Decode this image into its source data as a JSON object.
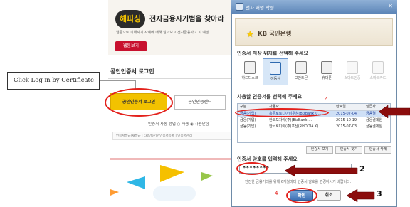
{
  "background_page": {
    "banner": {
      "logo": "해피싱",
      "title": "전자금융사기범을 찾아라",
      "subtitle": "웹툰으로 피해사기 사례에 대해 알아보고 전자금융사고 피 예방",
      "button": "웹툰보기"
    },
    "cert_login_title": "공인인증서 로그인",
    "login_button": "공인인증서 로그인",
    "center_button": "공인인증센터",
    "auto_login_label": "인증서 자동 갱업  ○ 사용  ◉ 사용안함",
    "links": "인증서발급/재발급 | 타행/타기관인증서등록 | 인증서관리"
  },
  "annotation": {
    "note": "Click Log in by Certificate",
    "step_numbers": [
      "2",
      "3"
    ],
    "small_numbers": [
      "2",
      "3",
      "4"
    ]
  },
  "dialog": {
    "title": "전자 서명 작성",
    "close": "✕",
    "bank_name": "KB 국민은행",
    "storage_section_title": "인증서 저장 위치를 선택해 주세요",
    "storage_options": [
      {
        "label": "하드디스크",
        "state": "normal"
      },
      {
        "label": "이동식",
        "state": "selected"
      },
      {
        "label": "보안토큰",
        "state": "normal"
      },
      {
        "label": "휴대폰",
        "state": "normal"
      },
      {
        "label": "스마트인증",
        "state": "disabled"
      },
      {
        "label": "스마트카드",
        "state": "disabled"
      }
    ],
    "cert_section_title": "사용할 인증서를 선택해 주세요",
    "table_headers": [
      "구분",
      "사용자",
      "만료일",
      "발급자"
    ],
    "table_rows": [
      [
        "금융(기업)",
        "홍루로로디아미우칭(BizBank)0...",
        "2015-07-04",
        "금융결"
      ],
      [
        "금융(기업)",
        "한로모자아(주)(BizBank)...",
        "2015-10-19",
        "금융결제원"
      ],
      [
        "금융(기업)",
        "한국로디아(주)포산(RHODIA K)...",
        "2015-07-03",
        "금융결제원"
      ]
    ],
    "table_buttons": [
      "인증서 보기",
      "인증서 찾기",
      "인증서 삭제"
    ],
    "password_section_title": "인증서 암호를 입력해 주세요",
    "password_value": "********",
    "password_hint": "안전한 금융거래를 위해 6개월마다 인증서 암호를 변경하시기 바랍니다.",
    "ok_button": "확인",
    "cancel_button": "취소"
  },
  "colors": {
    "annotation_red": "#e3211c",
    "kb_yellow": "#ffcc00",
    "login_yellow": "#f2c200",
    "dialog_titlebar": "#5d86b8"
  }
}
